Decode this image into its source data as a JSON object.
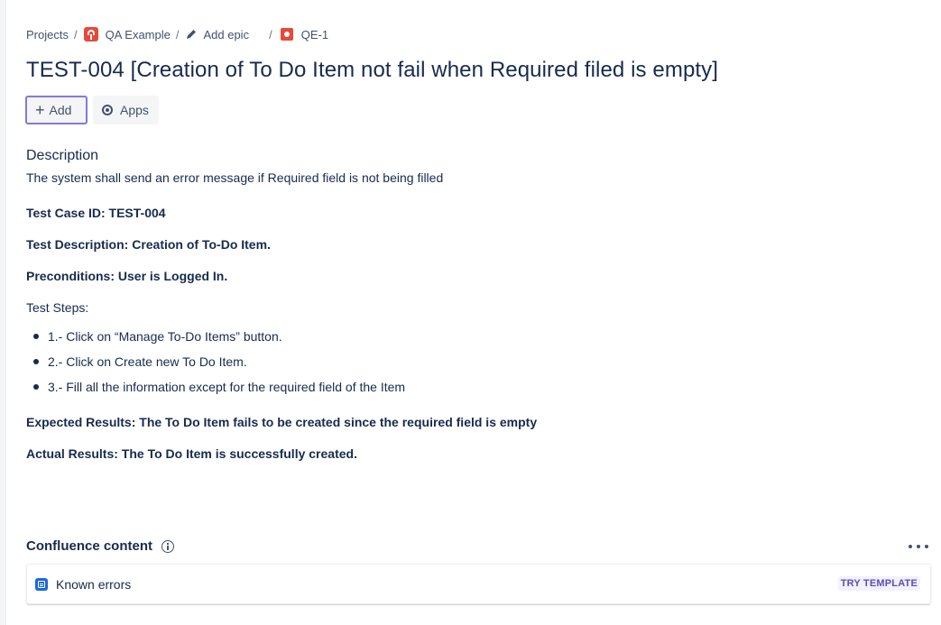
{
  "breadcrumb": {
    "projects": "Projects",
    "project_name": "QA Example",
    "epic": "Add epic",
    "issue_key": "QE-1",
    "separator": "/"
  },
  "issue": {
    "title": "TEST-004 [Creation of To Do Item not fail when Required filed is empty]"
  },
  "actions": {
    "add_label": "Add",
    "apps_label": "Apps"
  },
  "description": {
    "heading": "Description",
    "summary": "The system shall send an error message if Required field is not being filled",
    "test_case_id": "Test Case ID: TEST-004",
    "test_description": "Test Description: Creation of To-Do Item.",
    "preconditions": "Preconditions: User is Logged In.",
    "test_steps_label": "Test Steps:",
    "steps": [
      "1.- Click on “Manage To-Do Items” button.",
      "2.- Click on Create new To Do Item.",
      "3.- Fill all the information except for the required field of the Item"
    ],
    "expected_results": "Expected Results: The To Do Item fails to be created since the required field is empty",
    "actual_results": "Actual Results: The To Do Item is successfully created."
  },
  "confluence": {
    "heading": "Confluence content",
    "item_title": "Known errors",
    "badge": "TRY TEMPLATE"
  },
  "colors": {
    "text": "#172b4d",
    "add_border": "#8777d9",
    "badge_bg": "#f3f0ff",
    "badge_text": "#5e4db2",
    "project_icon": "#e5493a",
    "page_icon": "#1868db"
  },
  "icons": [
    "project-avatar-icon",
    "pencil-icon",
    "issue-type-icon",
    "plus-icon",
    "apps-icon",
    "info-icon",
    "more-icon",
    "confluence-page-icon"
  ]
}
